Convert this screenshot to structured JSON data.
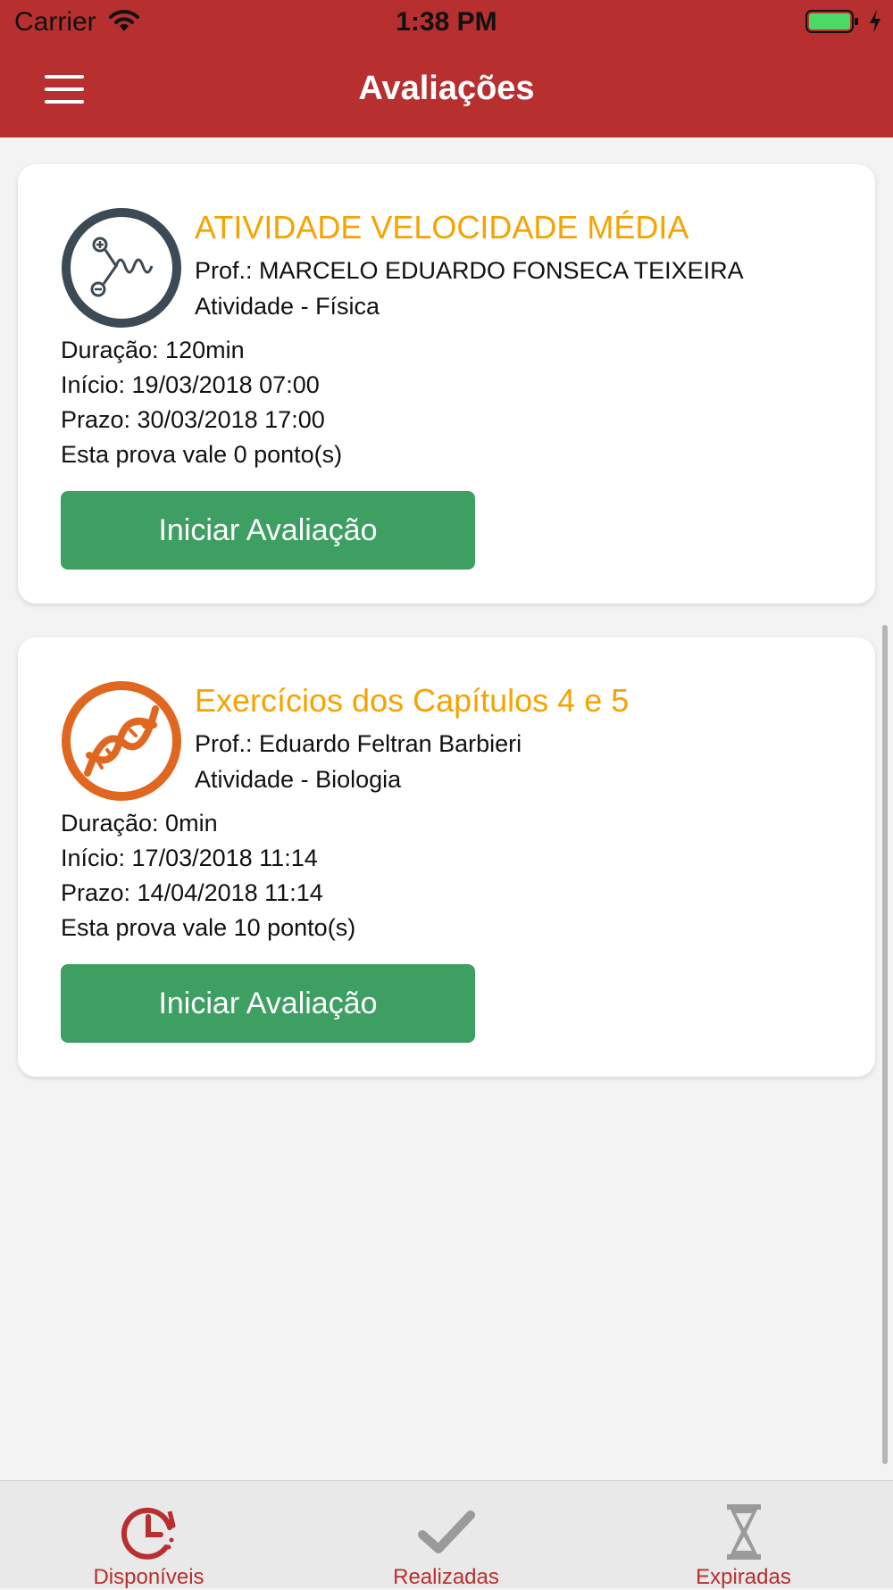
{
  "status_bar": {
    "carrier": "Carrier",
    "time": "1:38 PM"
  },
  "header": {
    "title": "Avaliações"
  },
  "evaluations": [
    {
      "title": "ATIVIDADE VELOCIDADE MÉDIA",
      "professor": "Prof.: MARCELO EDUARDO FONSECA TEIXEIRA",
      "subject": "Atividade - Física",
      "duration": "Duração: 120min",
      "start": "Início: 19/03/2018 07:00",
      "deadline": "Prazo: 30/03/2018 17:00",
      "points": "Esta prova vale 0 ponto(s)",
      "button_label": "Iniciar Avaliação",
      "icon": "physics-wave-icon",
      "icon_color": "#3b4a54"
    },
    {
      "title": "Exercícios dos Capítulos 4 e 5",
      "professor": "Prof.: Eduardo Feltran Barbieri",
      "subject": "Atividade - Biologia",
      "duration": "Duração: 0min",
      "start": "Início: 17/03/2018 11:14",
      "deadline": "Prazo: 14/04/2018 11:14",
      "points": "Esta prova vale 10 ponto(s)",
      "button_label": "Iniciar Avaliação",
      "icon": "dna-icon",
      "icon_color": "#e0671f"
    }
  ],
  "tabs": [
    {
      "label": "Disponíveis",
      "icon": "clock-refresh-icon",
      "active": true
    },
    {
      "label": "Realizadas",
      "icon": "checkmark-icon",
      "active": false
    },
    {
      "label": "Expiradas",
      "icon": "hourglass-icon",
      "active": false
    }
  ],
  "colors": {
    "brand_red": "#b82f2f",
    "title_orange": "#f5a300",
    "button_green": "#3d9f62",
    "inactive_icon": "#9a9a9a"
  }
}
